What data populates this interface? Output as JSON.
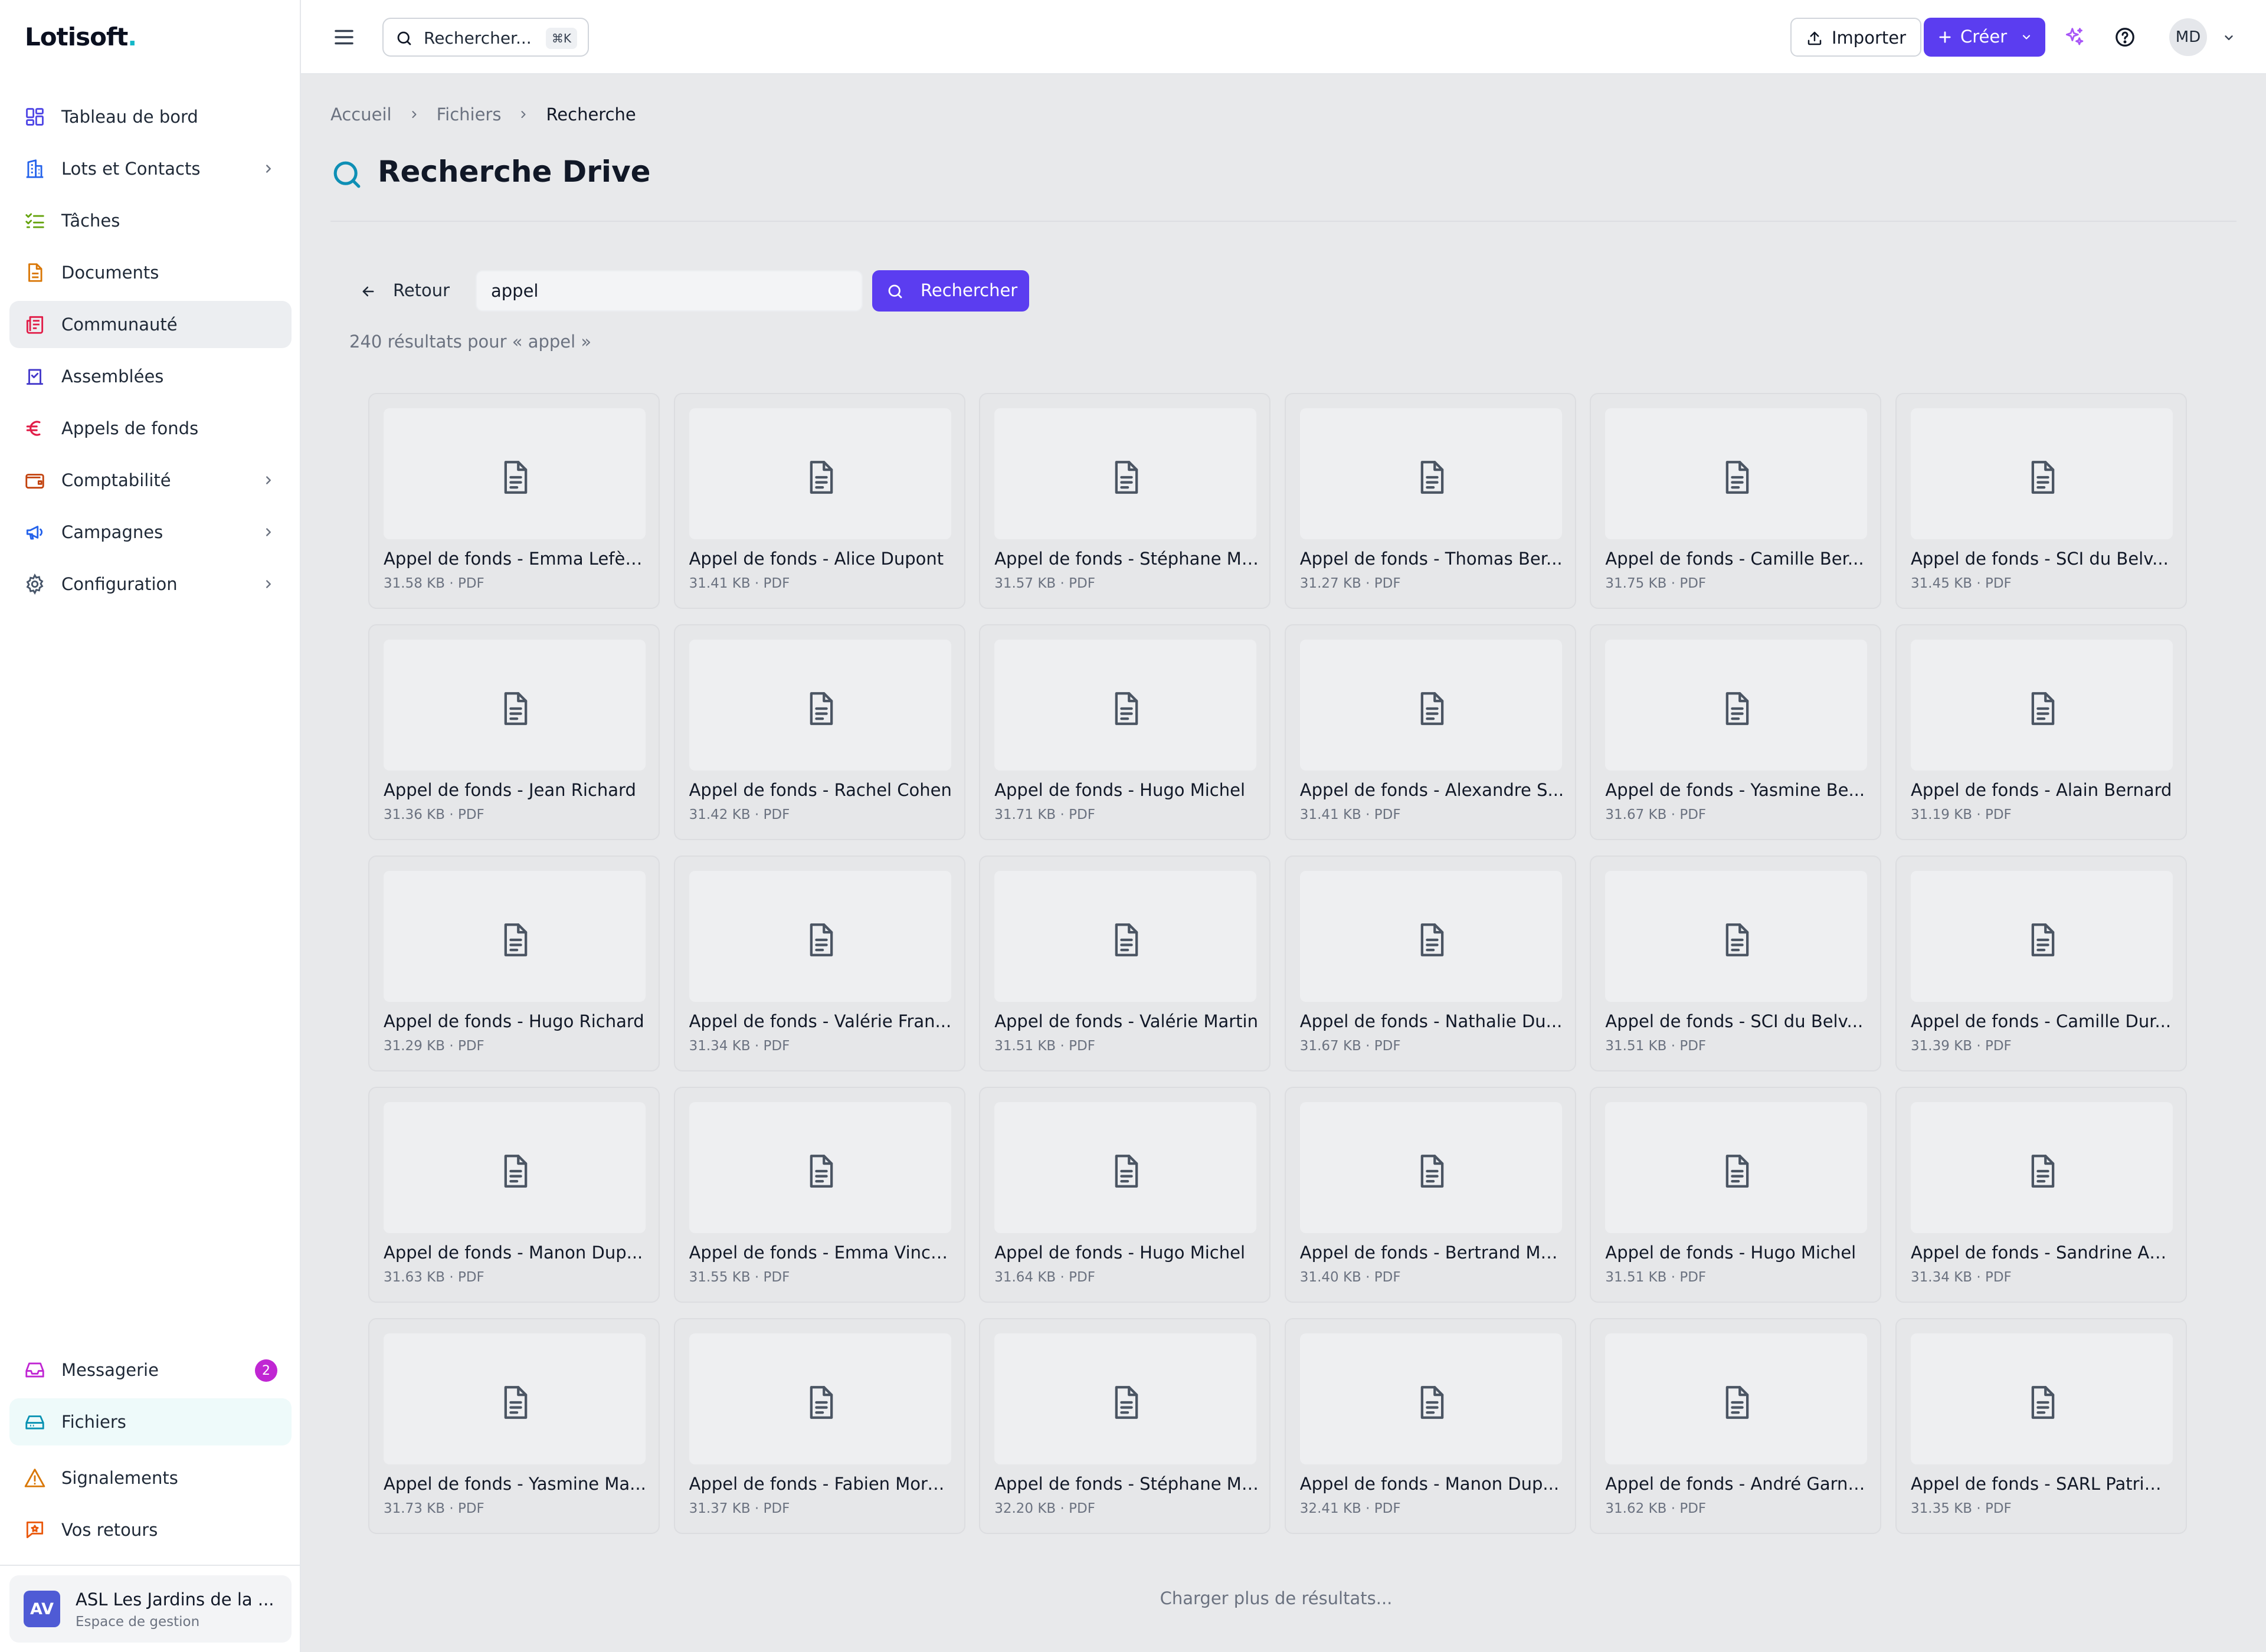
{
  "app": {
    "logo": "Lotisoft",
    "logo_dot": "."
  },
  "sidebar": {
    "items": [
      {
        "label": "Tableau de bord",
        "icon": "dashboard-icon",
        "has_chevron": false
      },
      {
        "label": "Lots et Contacts",
        "icon": "building-icon",
        "has_chevron": true
      },
      {
        "label": "Tâches",
        "icon": "checklist-icon",
        "has_chevron": false
      },
      {
        "label": "Documents",
        "icon": "document-icon",
        "has_chevron": false
      },
      {
        "label": "Communauté",
        "icon": "newspaper-icon",
        "has_chevron": false,
        "active": true
      },
      {
        "label": "Assemblées",
        "icon": "vote-icon",
        "has_chevron": false
      },
      {
        "label": "Appels de fonds",
        "icon": "euro-icon",
        "has_chevron": false
      },
      {
        "label": "Comptabilité",
        "icon": "wallet-icon",
        "has_chevron": true
      },
      {
        "label": "Campagnes",
        "icon": "megaphone-icon",
        "has_chevron": true
      },
      {
        "label": "Configuration",
        "icon": "gear-icon",
        "has_chevron": true
      }
    ],
    "bottom_items": [
      {
        "label": "Messagerie",
        "icon": "inbox-icon",
        "badge": "2"
      },
      {
        "label": "Fichiers",
        "icon": "drive-icon",
        "active": true
      },
      {
        "label": "Signalements",
        "icon": "warning-icon"
      },
      {
        "label": "Vos retours",
        "icon": "feedback-icon"
      }
    ],
    "org": {
      "initials": "AV",
      "name": "ASL Les Jardins de la ...",
      "subtitle": "Espace de gestion"
    }
  },
  "header": {
    "search_placeholder": "Rechercher...",
    "search_shortcut": "⌘K",
    "import_label": "Importer",
    "create_label": "Créer",
    "user_initials": "MD"
  },
  "breadcrumb": [
    "Accueil",
    "Fichiers",
    "Recherche"
  ],
  "page": {
    "title": "Recherche Drive",
    "back_label": "Retour",
    "query": "appel",
    "search_button": "Rechercher",
    "results_count": "240 résultats pour « appel »",
    "load_more": "Charger plus de résultats..."
  },
  "colors": {
    "accent": "#5b3df0",
    "title_icon": "#0e8fb5",
    "badge": "#c026d3"
  },
  "results": [
    {
      "name": "Appel de fonds - Emma Lefèvre",
      "meta": "31.58 KB · PDF"
    },
    {
      "name": "Appel de fonds - Alice Dupont",
      "meta": "31.41 KB · PDF"
    },
    {
      "name": "Appel de fonds - Stéphane Mi...",
      "meta": "31.57 KB · PDF"
    },
    {
      "name": "Appel de fonds - Thomas Ber...",
      "meta": "31.27 KB · PDF"
    },
    {
      "name": "Appel de fonds - Camille Ber...",
      "meta": "31.75 KB · PDF"
    },
    {
      "name": "Appel de fonds - SCI du Belv...",
      "meta": "31.45 KB · PDF"
    },
    {
      "name": "Appel de fonds - Jean Richard",
      "meta": "31.36 KB · PDF"
    },
    {
      "name": "Appel de fonds - Rachel Cohen",
      "meta": "31.42 KB · PDF"
    },
    {
      "name": "Appel de fonds - Hugo Michel",
      "meta": "31.71 KB · PDF"
    },
    {
      "name": "Appel de fonds - Alexandre S...",
      "meta": "31.41 KB · PDF"
    },
    {
      "name": "Appel de fonds - Yasmine Be...",
      "meta": "31.67 KB · PDF"
    },
    {
      "name": "Appel de fonds - Alain Bernard",
      "meta": "31.19 KB · PDF"
    },
    {
      "name": "Appel de fonds - Hugo Richard",
      "meta": "31.29 KB · PDF"
    },
    {
      "name": "Appel de fonds - Valérie Fran...",
      "meta": "31.34 KB · PDF"
    },
    {
      "name": "Appel de fonds - Valérie Martin",
      "meta": "31.51 KB · PDF"
    },
    {
      "name": "Appel de fonds - Nathalie Du...",
      "meta": "31.67 KB · PDF"
    },
    {
      "name": "Appel de fonds - SCI du Belv...",
      "meta": "31.51 KB · PDF"
    },
    {
      "name": "Appel de fonds - Camille Dur...",
      "meta": "31.39 KB · PDF"
    },
    {
      "name": "Appel de fonds - Manon Dup...",
      "meta": "31.63 KB · PDF"
    },
    {
      "name": "Appel de fonds - Emma Vincent",
      "meta": "31.55 KB · PDF"
    },
    {
      "name": "Appel de fonds - Hugo Michel",
      "meta": "31.64 KB · PDF"
    },
    {
      "name": "Appel de fonds - Bertrand Ma...",
      "meta": "31.40 KB · PDF"
    },
    {
      "name": "Appel de fonds - Hugo Michel",
      "meta": "31.51 KB · PDF"
    },
    {
      "name": "Appel de fonds - Sandrine An...",
      "meta": "31.34 KB · PDF"
    },
    {
      "name": "Appel de fonds - Yasmine Ma...",
      "meta": "31.73 KB · PDF"
    },
    {
      "name": "Appel de fonds - Fabien More...",
      "meta": "31.37 KB · PDF"
    },
    {
      "name": "Appel de fonds - Stéphane Mi...",
      "meta": "32.20 KB · PDF"
    },
    {
      "name": "Appel de fonds - Manon Dup...",
      "meta": "32.41 KB · PDF"
    },
    {
      "name": "Appel de fonds - André Garnier",
      "meta": "31.62 KB · PDF"
    },
    {
      "name": "Appel de fonds - SARL Patrim...",
      "meta": "31.35 KB · PDF"
    }
  ]
}
